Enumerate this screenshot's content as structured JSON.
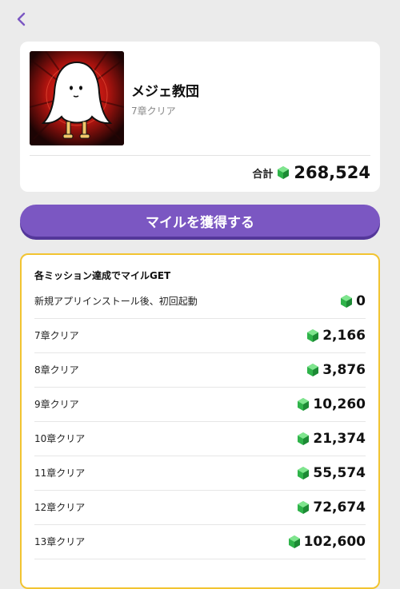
{
  "header": {
    "back_icon": "chevron-left-icon"
  },
  "game": {
    "title": "メジェ教団",
    "subtitle": "7章クリア",
    "total_label": "合計",
    "total_value": "268,524"
  },
  "earn_button": {
    "label": "マイルを獲得する"
  },
  "missions": {
    "title": "各ミッション達成でマイルGET",
    "items": [
      {
        "label": "新規アプリインストール後、初回起動",
        "reward": "0"
      },
      {
        "label": "7章クリア",
        "reward": "2,166"
      },
      {
        "label": "8章クリア",
        "reward": "3,876"
      },
      {
        "label": "9章クリア",
        "reward": "10,260"
      },
      {
        "label": "10章クリア",
        "reward": "21,374"
      },
      {
        "label": "11章クリア",
        "reward": "55,574"
      },
      {
        "label": "12章クリア",
        "reward": "72,674"
      },
      {
        "label": "13章クリア",
        "reward": "102,600"
      }
    ]
  },
  "colors": {
    "accent": "#7b57c2",
    "border": "#f2c431",
    "gem": "#2fb34a"
  }
}
